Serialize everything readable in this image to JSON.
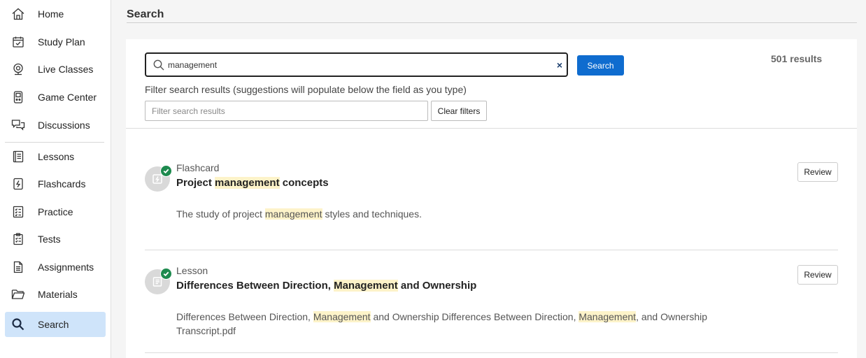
{
  "sidebar": {
    "items": [
      {
        "label": "Home",
        "icon": "home-icon"
      },
      {
        "label": "Study Plan",
        "icon": "calendar-check-icon"
      },
      {
        "label": "Live Classes",
        "icon": "webcam-icon"
      },
      {
        "label": "Game Center",
        "icon": "game-controller-icon"
      },
      {
        "label": "Discussions",
        "icon": "chat-bubbles-icon"
      },
      {
        "label": "Lessons",
        "icon": "book-icon"
      },
      {
        "label": "Flashcards",
        "icon": "flashcard-icon"
      },
      {
        "label": "Practice",
        "icon": "checklist-icon"
      },
      {
        "label": "Tests",
        "icon": "clipboard-icon"
      },
      {
        "label": "Assignments",
        "icon": "document-icon"
      },
      {
        "label": "Materials",
        "icon": "folder-icon"
      },
      {
        "label": "Search",
        "icon": "search-icon"
      }
    ],
    "active": "Search"
  },
  "page": {
    "title": "Search"
  },
  "search": {
    "value": "management",
    "clear_symbol": "×",
    "button_label": "Search",
    "result_count": "501 results"
  },
  "filter": {
    "label": "Filter search results (suggestions will populate below the field as you type)",
    "placeholder": "Filter search results",
    "clear_label": "Clear filters"
  },
  "results": [
    {
      "type": "Flashcard",
      "title_parts": [
        "Project ",
        "management",
        " concepts"
      ],
      "desc_parts": [
        "The study of project ",
        "management",
        " styles and techniques."
      ],
      "review_label": "Review"
    },
    {
      "type": "Lesson",
      "title_parts": [
        "Differences Between Direction, ",
        "Management",
        " and Ownership"
      ],
      "desc_parts": [
        "Differences Between Direction, ",
        "Management",
        " and Ownership Differences Between Direction, ",
        "Management",
        ", and Ownership Transcript.pdf"
      ],
      "review_label": "Review"
    }
  ],
  "colors": {
    "accent": "#0f6ccf",
    "active_nav": "#cfe4fa",
    "highlight": "#fdf3c9",
    "complete": "#1d8a4e"
  }
}
